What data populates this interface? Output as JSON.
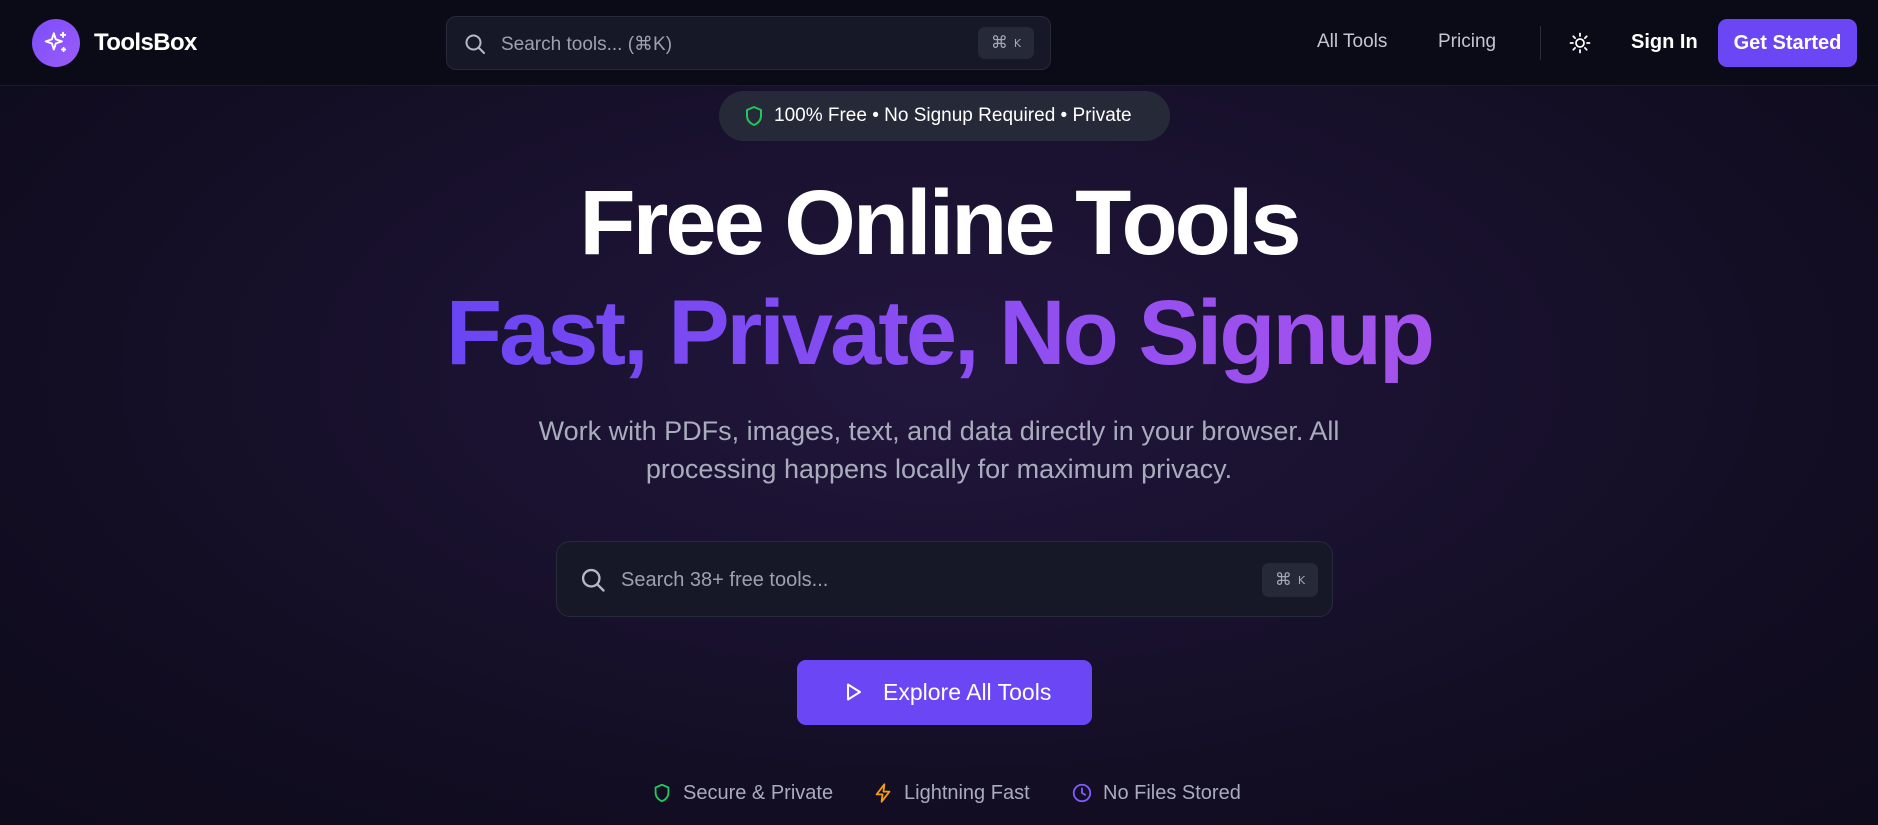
{
  "brand": {
    "name": "ToolsBox",
    "logo_icon": "sparkles-icon",
    "logo_color": "#7c4dff"
  },
  "header": {
    "search": {
      "placeholder": "Search tools... (⌘K)",
      "shortcut_cmd": "⌘",
      "shortcut_key": "K"
    },
    "nav": {
      "all_tools": "All Tools",
      "pricing": "Pricing",
      "theme_icon": "sun-icon",
      "sign_in": "Sign In",
      "get_started": "Get Started"
    }
  },
  "badge": {
    "icon": "shield-icon",
    "text": "100% Free • No Signup Required • Private",
    "icon_color": "#22c55e"
  },
  "hero": {
    "title": "Free Online Tools",
    "subtitle": "Fast, Private, No Signup",
    "description": "Work with PDFs, images, text, and data directly in your browser. All processing happens locally for maximum privacy."
  },
  "main_search": {
    "placeholder": "Search 38+ free tools...",
    "shortcut_cmd": "⌘",
    "shortcut_key": "K"
  },
  "cta": {
    "label": "Explore All Tools",
    "icon": "play-icon"
  },
  "features": [
    {
      "label": "Secure & Private",
      "icon": "shield-icon",
      "color": "#22c55e"
    },
    {
      "label": "Lightning Fast",
      "icon": "lightning-icon",
      "color": "#f59e0b"
    },
    {
      "label": "No Files Stored",
      "icon": "clock-icon",
      "color": "#7c5cff"
    }
  ],
  "colors": {
    "accent": "#6b46f5",
    "gradient_start": "#6a45f3",
    "gradient_end": "#a652ec",
    "background": "#120d22"
  }
}
